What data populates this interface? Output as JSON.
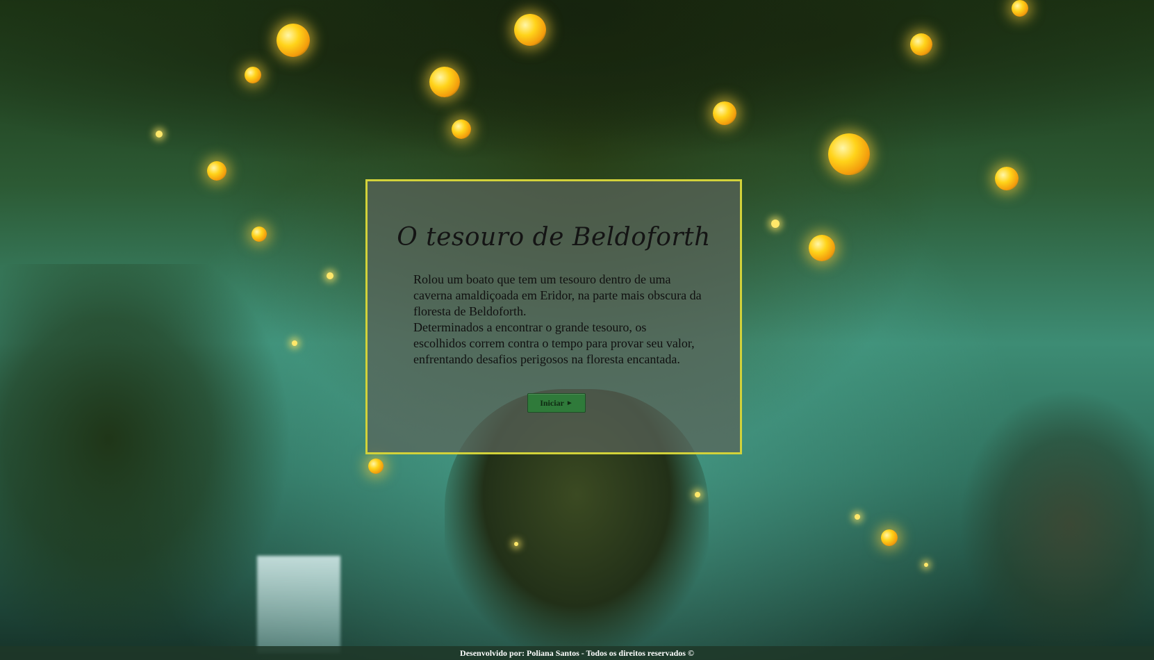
{
  "panel": {
    "title": "O tesouro de Beldoforth",
    "paragraph_1": "Rolou um boato que tem um tesouro dentro de uma caverna amaldiçoada em Eridor, na parte mais obscura da floresta de Beldoforth.",
    "paragraph_2": "Determinados a encontrar o grande tesouro, os escolhidos correm contra o tempo para provar seu valor, enfrentando desafios perigosos na floresta encantada.",
    "start_button_label": "Iniciar",
    "start_button_icon": "play-arrow-icon"
  },
  "footer": {
    "text": "Desenvolvido por: Poliana Santos - Todos os direitos reservados ©"
  },
  "colors": {
    "panel_border": "#d2d23a",
    "button_green": "#2f7a3a",
    "orb_gold": "#ffd31a"
  }
}
